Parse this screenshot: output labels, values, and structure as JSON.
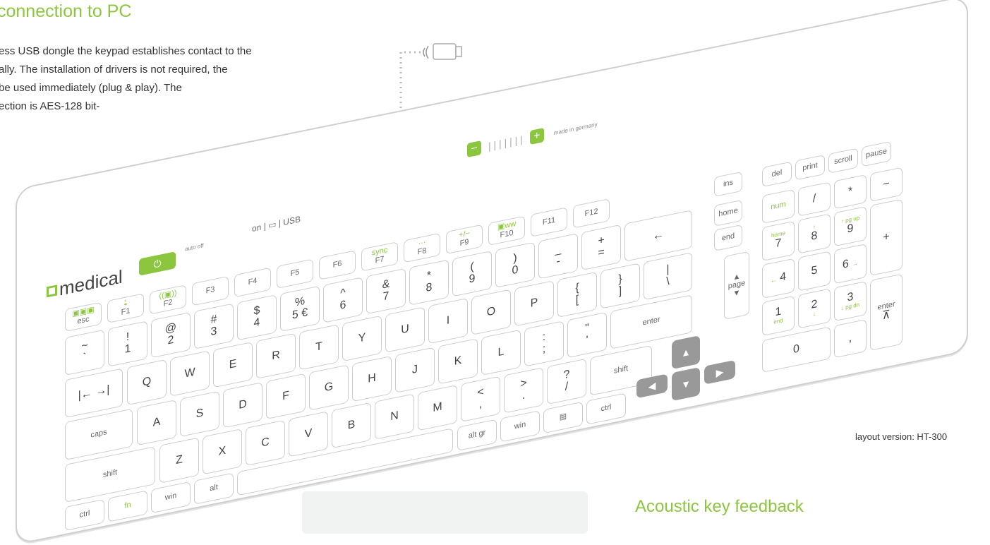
{
  "heading": "connection to PC",
  "paragraph": {
    "lines": [
      "ess USB dongle the keypad establishes contact to the",
      "ally. The installation of drivers is not required, the",
      " be used immediately (plug & play). The",
      "ection is AES-128 bit-"
    ]
  },
  "keyboard": {
    "brand": "medical",
    "power_icon": "power-icon",
    "auto_off": "auto off",
    "on_label": "on",
    "usb_label": "USB",
    "slider_minus": "−",
    "slider_plus": "+",
    "made_in": "made in germany",
    "function_row": [
      {
        "name": "esc",
        "label": "esc",
        "green": "▣▣▣"
      },
      {
        "name": "F1",
        "label": "F1",
        "green": "⇣"
      },
      {
        "name": "F2",
        "label": "F2",
        "green": "((▣))"
      },
      {
        "name": "F3",
        "label": "F3"
      },
      {
        "name": "F4",
        "label": "F4"
      },
      {
        "name": "F5",
        "label": "F5"
      },
      {
        "name": "F6",
        "label": "F6"
      },
      {
        "name": "F7",
        "label": "F7",
        "green": "sync"
      },
      {
        "name": "F8",
        "label": "F8",
        "green": "···"
      },
      {
        "name": "F9",
        "label": "F9",
        "green": "+/−"
      },
      {
        "name": "F10",
        "label": "F10",
        "green": "▣ww"
      },
      {
        "name": "F11",
        "label": "F11"
      },
      {
        "name": "F12",
        "label": "F12"
      }
    ],
    "number_row": [
      {
        "top": "~",
        "bottom": "`"
      },
      {
        "top": "!",
        "bottom": "1"
      },
      {
        "top": "@",
        "bottom": "2"
      },
      {
        "top": "#",
        "bottom": "3"
      },
      {
        "top": "$",
        "bottom": "4"
      },
      {
        "top": "%",
        "bottom": "5 €"
      },
      {
        "top": "^",
        "bottom": "6"
      },
      {
        "top": "&",
        "bottom": "7"
      },
      {
        "top": "*",
        "bottom": "8"
      },
      {
        "top": "(",
        "bottom": "9"
      },
      {
        "top": ")",
        "bottom": "0"
      },
      {
        "top": "_",
        "bottom": "-"
      },
      {
        "top": "+",
        "bottom": "="
      }
    ],
    "backspace": "←",
    "tab": "|← →|",
    "q_row": [
      "Q",
      "W",
      "E",
      "R",
      "T",
      "Y",
      "U",
      "I",
      "O",
      "P"
    ],
    "q_row_extra": [
      {
        "top": "{",
        "bottom": "["
      },
      {
        "top": "}",
        "bottom": "]"
      },
      {
        "top": "|",
        "bottom": "\\"
      }
    ],
    "caps": "caps",
    "a_row": [
      "A",
      "S",
      "D",
      "F",
      "G",
      "H",
      "J",
      "K",
      "L"
    ],
    "a_row_extra": [
      {
        "top": ":",
        "bottom": ";"
      },
      {
        "top": "\"",
        "bottom": "'"
      }
    ],
    "enter": "enter",
    "shift_left": "shift",
    "z_row": [
      "Z",
      "X",
      "C",
      "V",
      "B",
      "N",
      "M"
    ],
    "z_row_extra": [
      {
        "top": "<",
        "bottom": ","
      },
      {
        "top": ">",
        "bottom": "."
      },
      {
        "top": "?",
        "bottom": "/"
      }
    ],
    "shift_right": "shift",
    "bottom_row": {
      "ctrl_left": "ctrl",
      "fn": "fn",
      "win_left": "win",
      "alt": "alt",
      "alt_gr": "alt gr",
      "win_right": "win",
      "menu": "▤",
      "ctrl_right": "ctrl"
    },
    "nav": {
      "ins": "ins",
      "home": "home",
      "end": "end",
      "page": "page",
      "up": "▲",
      "down": "▼"
    },
    "arrows": {
      "up": "▲",
      "left": "◀",
      "down": "▼",
      "right": "▶"
    },
    "top_right": [
      "del",
      "print",
      "scroll",
      "pause"
    ],
    "numpad": {
      "num": "num",
      "div": "/",
      "mul": "*",
      "minus": "−",
      "plus": "+",
      "enter": "enter",
      "k7": {
        "main": "7",
        "alt": "home"
      },
      "k8": {
        "main": "8",
        "alt": "↑"
      },
      "k9": {
        "main": "9",
        "alt": "↑ pg up"
      },
      "k4": {
        "main": "4",
        "alt": "←"
      },
      "k5": {
        "main": "5"
      },
      "k6": {
        "main": "6",
        "alt": "→"
      },
      "k1": {
        "main": "1",
        "alt": "end"
      },
      "k2": {
        "main": "2",
        "alt": "↓"
      },
      "k3": {
        "main": "3",
        "alt": "↓ pg dn"
      },
      "k0": {
        "main": "0"
      },
      "comma": ",",
      "overline": "⊼"
    }
  },
  "layout_version": "layout version: HT-300",
  "subheading": "Acoustic key feedback"
}
